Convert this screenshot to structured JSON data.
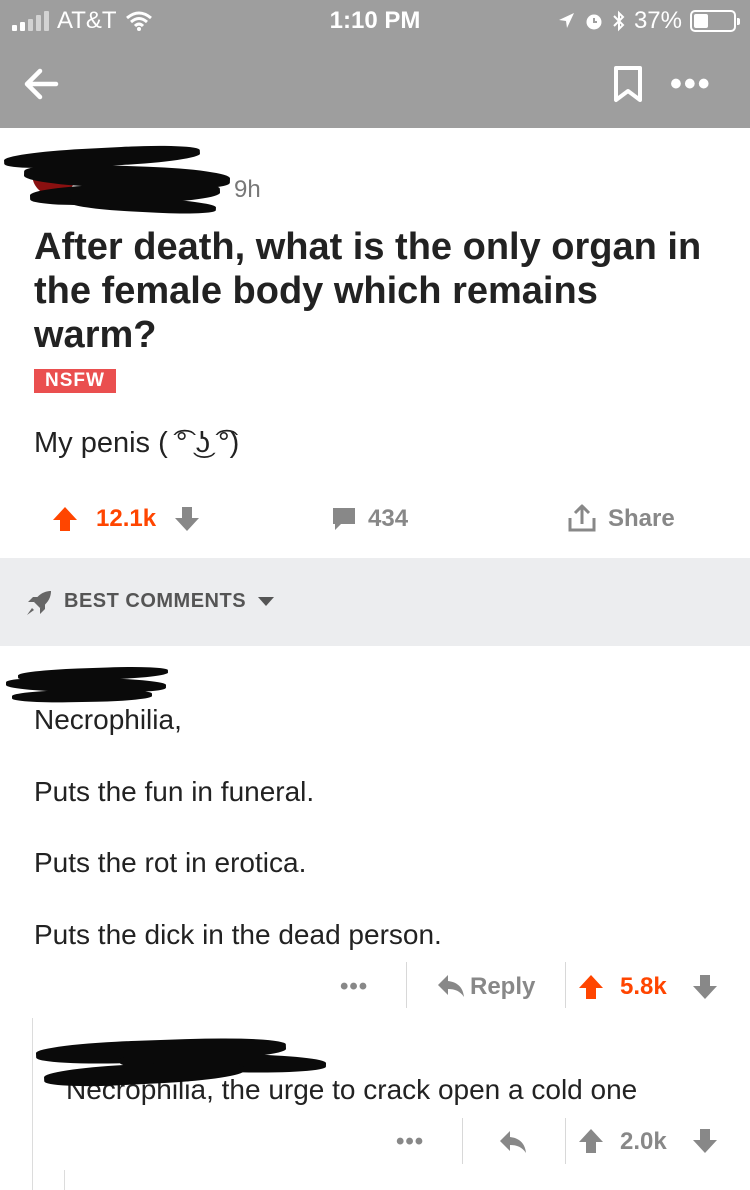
{
  "status_bar": {
    "carrier": "AT&T",
    "time": "1:10 PM",
    "battery": "37%",
    "battery_level": 0.37
  },
  "nav": {
    "back_icon": "arrow-left-icon",
    "save_icon": "bookmark-icon",
    "more_label": "•••"
  },
  "post": {
    "age": "9h",
    "title": "After death, what is the only organ in the female body which remains warm?",
    "nsfw_label": "NSFW",
    "body": "My penis ( ͡° ͜ʖ ͡°)",
    "score": "12.1k",
    "comments": "434",
    "share_label": "Share"
  },
  "sort": {
    "label": "BEST COMMENTS",
    "icon": "rocket-icon"
  },
  "comment": {
    "lines": [
      "Necrophilia,",
      "Puts the fun in funeral.",
      "Puts the rot in erotica.",
      "Puts the dick in the dead person."
    ],
    "more_label": "•••",
    "reply_label": "Reply",
    "score": "5.8k"
  },
  "reply": {
    "text": "Necrophilia, the urge to crack open a cold one",
    "more_label": "•••",
    "score": "2.0k"
  },
  "colors": {
    "upvote": "#ff4500",
    "nsfw": "#ea4f4f",
    "header": "#9e9e9e"
  }
}
